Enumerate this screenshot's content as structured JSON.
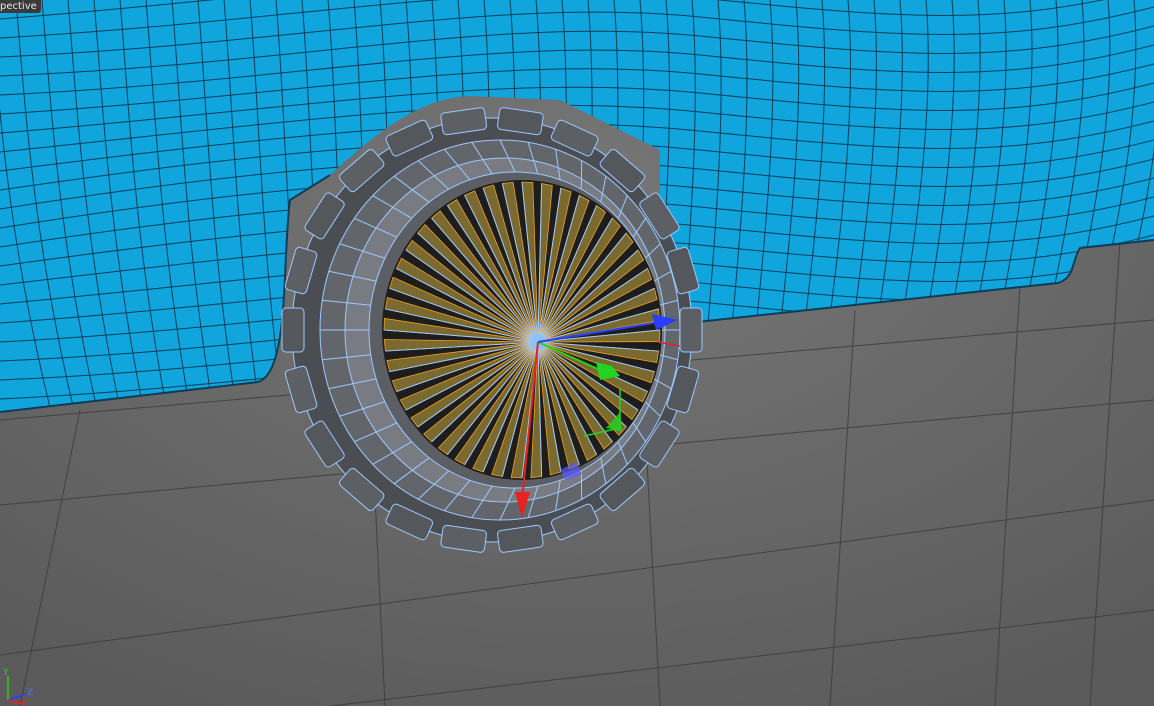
{
  "viewport": {
    "label": "pective",
    "colors": {
      "mesh_surface": "#10a5dd",
      "mesh_wire": "#0c3d57",
      "floor": "#6b6b6b",
      "wheel_dark": "#54585d",
      "wheel_light": "#7d8186",
      "wheel_edge": "#9ec8ff",
      "spoke_face": "#7a6a30",
      "spoke_edge": "#f0a020",
      "axis_x": "#e82020",
      "axis_y": "#21d421",
      "axis_z": "#2a3dff"
    }
  },
  "axis_indicator": {
    "y": "Y",
    "z": "Z",
    "x": "X"
  },
  "gizmo": {
    "x_handle": "x-axis-handle",
    "y_handle": "y-axis-handle",
    "z_handle": "z-axis-handle"
  }
}
